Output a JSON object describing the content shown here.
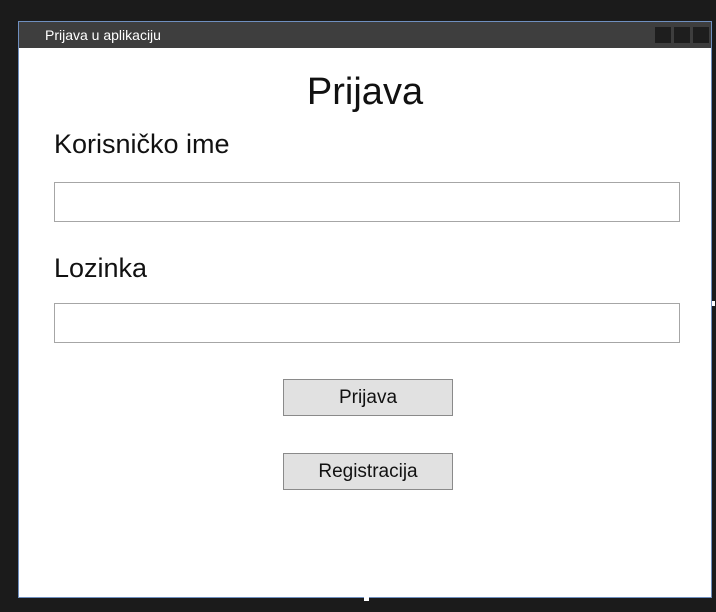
{
  "window": {
    "title": "Prijava u aplikaciju"
  },
  "form": {
    "heading": "Prijava",
    "username_label": "Korisničko ime",
    "username_value": "",
    "password_label": "Lozinka",
    "password_value": "",
    "login_button": "Prijava",
    "register_button": "Registracija"
  },
  "colors": {
    "titlebar": "#3e3e3e",
    "window_border": "#6f8fbf",
    "button_bg": "#e1e1e1",
    "background": "#1b1b1b"
  },
  "icons": [
    "minimize-icon",
    "maximize-icon",
    "close-icon"
  ]
}
